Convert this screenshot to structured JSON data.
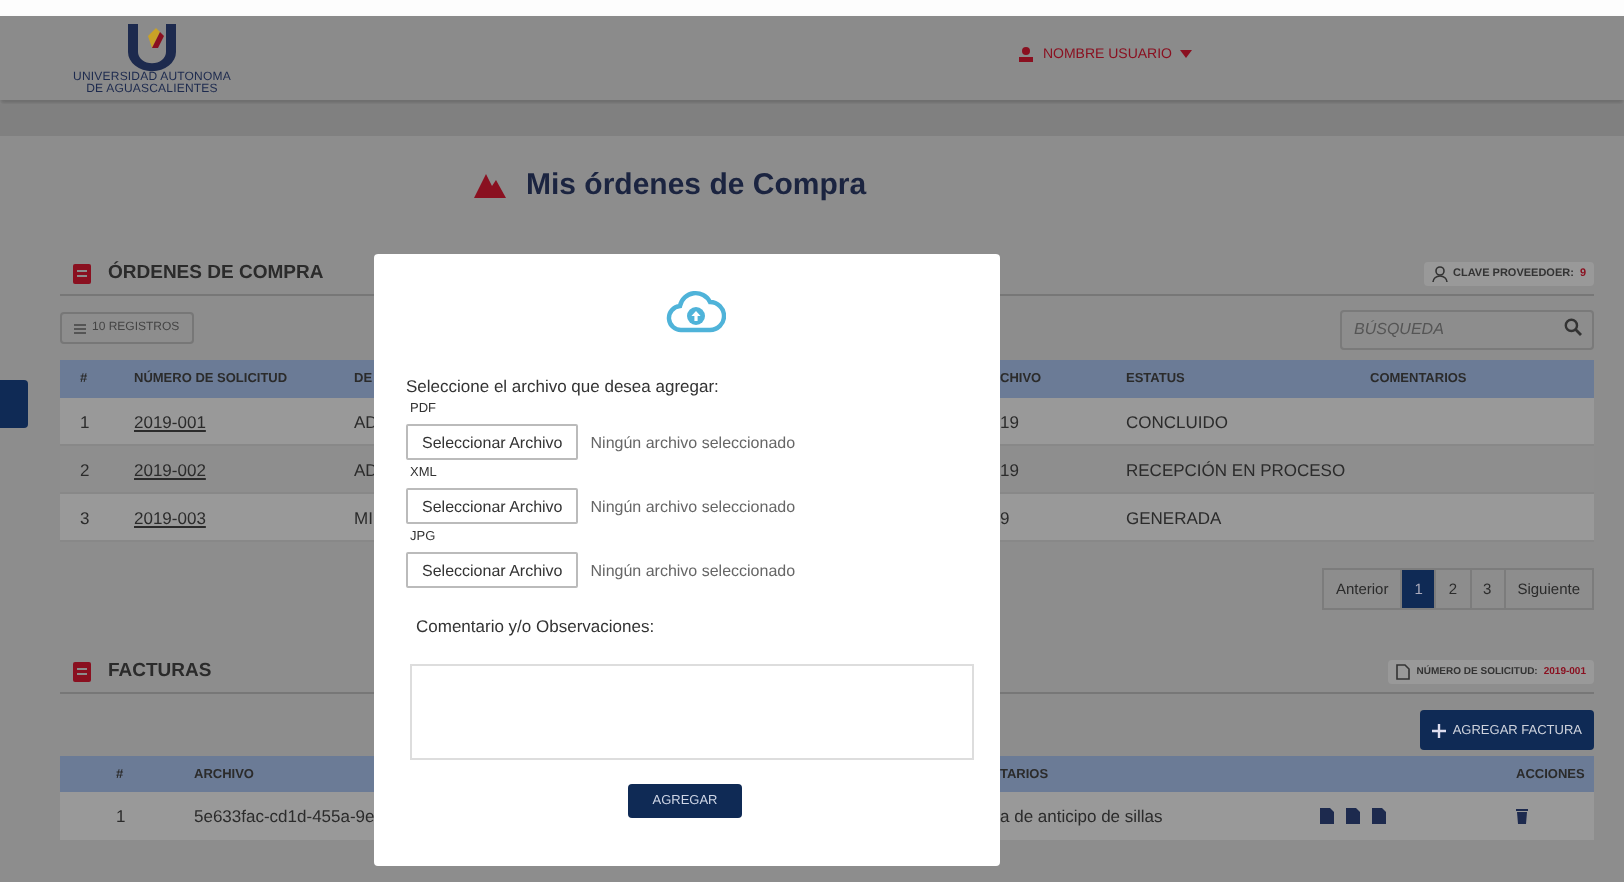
{
  "header": {
    "logo_line1": "UNIVERSIDAD AUTONOMA",
    "logo_line2": "DE AGUASCALIENTES",
    "user_menu": "NOMBRE USUARIO"
  },
  "page_title": "Mis órdenes de Compra",
  "orders": {
    "title": "ÓRDENES DE COMPRA",
    "badge_label": "CLAVE PROVEEDOER:",
    "badge_value": "9",
    "records_button": "10 REGISTROS",
    "search": {
      "placeholder": "BÚSQUEDA"
    },
    "columns": [
      "#",
      "NÚMERO DE SOLICITUD",
      "DE",
      "CHIVO",
      "ESTATUS",
      "COMENTARIOS"
    ],
    "rows": [
      {
        "index": "1",
        "request": "2019-001",
        "column_3": "AD",
        "column_4": "19",
        "status": "CONCLUIDO"
      },
      {
        "index": "2",
        "request": "2019-002",
        "column_3": "AD",
        "column_4": "19",
        "status": "RECEPCIÓN EN PROCESO"
      },
      {
        "index": "3",
        "request": "2019-003",
        "column_3": "MI",
        "column_4": "9",
        "status": "GENERADA"
      }
    ],
    "pagination": [
      {
        "label": "Anterior",
        "selected": false
      },
      {
        "label": "1",
        "selected": true
      },
      {
        "label": "2",
        "selected": false
      },
      {
        "label": "3",
        "selected": false
      },
      {
        "label": "Siguiente",
        "selected": false
      }
    ]
  },
  "invoices": {
    "title": "FACTURAS",
    "badge_label": "NÚMERO DE SOLICITUD:",
    "badge_value": "2019-001",
    "add_button": "AGREGAR FACTURA",
    "columns": [
      "#",
      "ARCHIVO",
      "TARIOS",
      "ACCIONES"
    ],
    "rows": [
      {
        "index": "1",
        "file": "5e633fac-cd1d-455a-9e",
        "comment": "a de anticipo de sillas"
      }
    ]
  },
  "modal": {
    "prompt": "Seleccione el archivo que desea agregar:",
    "files": [
      {
        "label": "PDF",
        "button": "Seleccionar Archivo",
        "status": "Ningún archivo seleccionado"
      },
      {
        "label": "XML",
        "button": "Seleccionar Archivo",
        "status": "Ningún archivo seleccionado"
      },
      {
        "label": "JPG",
        "button": "Seleccionar Archivo",
        "status": "Ningún archivo seleccionado"
      }
    ],
    "comment_label": "Comentario y/o Observaciones:",
    "submit": "AGREGAR"
  }
}
